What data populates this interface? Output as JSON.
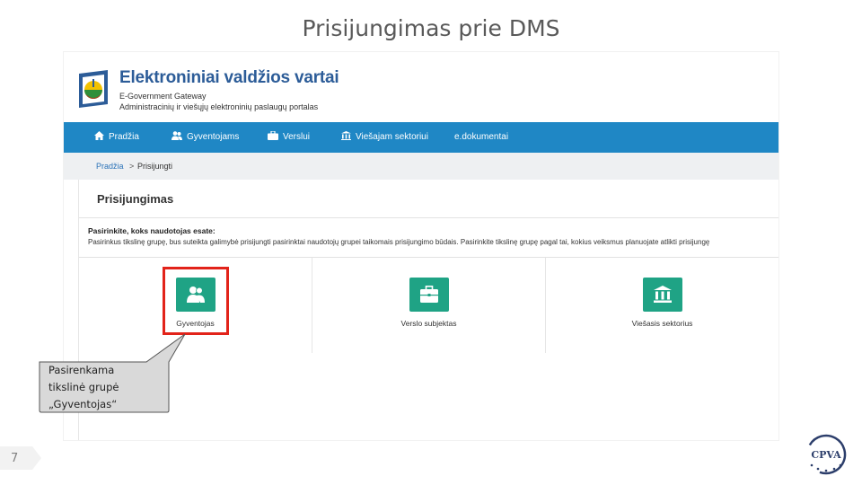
{
  "slide": {
    "title": "Prisijungimas prie DMS",
    "page_number": "7"
  },
  "site": {
    "title": "Elektroniniai valdžios vartai",
    "subtitle_en": "E-Government Gateway",
    "subtitle_lt": "Administracinių ir viešųjų elektroninių paslaugų portalas"
  },
  "nav": {
    "items": [
      {
        "label": "Pradžia",
        "icon": "home-icon"
      },
      {
        "label": "Gyventojams",
        "icon": "people-icon"
      },
      {
        "label": "Verslui",
        "icon": "briefcase-icon"
      },
      {
        "label": "Viešajam sektoriui",
        "icon": "institution-icon"
      },
      {
        "label": "e.dokumentai",
        "icon": ""
      }
    ]
  },
  "breadcrumb": {
    "home": "Pradžia",
    "separator": ">",
    "current": "Prisijungti"
  },
  "login": {
    "heading": "Prisijungimas",
    "choose_heading": "Pasirinkite, koks naudotojas esate:",
    "choose_description": "Pasirinkus tikslinę grupę, bus suteikta galimybė prisijungti pasirinktai naudotojų grupei taikomais prisijungimo būdais. Pasirinkite tikslinę grupę pagal tai, kokius veiksmus planuojate atlikti prisijungę",
    "options": [
      {
        "label": "Gyventojas",
        "icon": "people-icon",
        "highlighted": true
      },
      {
        "label": "Verslo subjektas",
        "icon": "briefcase-icon",
        "highlighted": false
      },
      {
        "label": "Viešasis sektorius",
        "icon": "institution-icon",
        "highlighted": false
      }
    ]
  },
  "callout": {
    "line1": "Pasirenkama",
    "line2": "tikslinė grupė",
    "line3": "„Gyventojas“"
  },
  "colors": {
    "nav_blue": "#1f87c5",
    "tile_green": "#1fa385",
    "highlight_red": "#e2231a",
    "brand_blue": "#2c5c98"
  }
}
